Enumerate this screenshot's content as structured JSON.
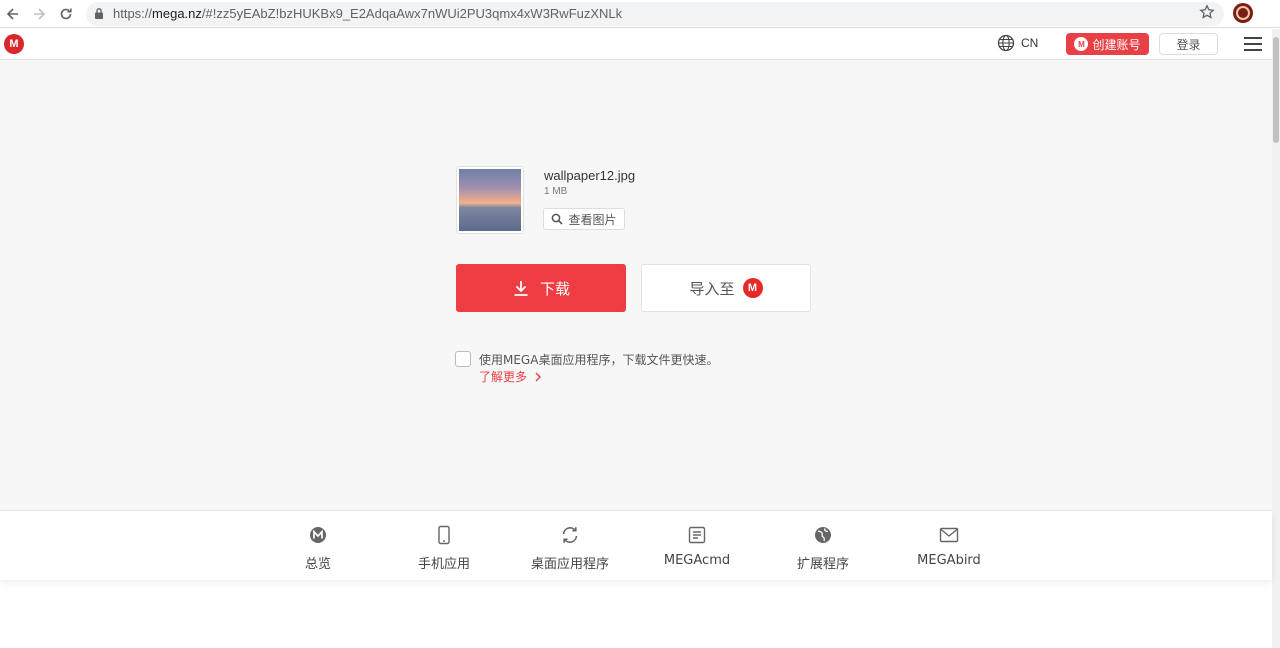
{
  "browser": {
    "url_scheme": "https://",
    "url_host": "mega.nz",
    "url_rest": "/#!zz5yEAbZ!bzHUKBx9_E2AdqaAwx7nWUi2PU3qmx4xW3RwFuzXNLk"
  },
  "topnav": {
    "logo": "M",
    "language": "CN",
    "create_account": "创建账号",
    "login": "登录"
  },
  "file": {
    "name": "wallpaper12.jpg",
    "size": "1 MB",
    "preview_label": "查看图片"
  },
  "actions": {
    "download": "下载",
    "import_to": "导入至",
    "import_badge": "M"
  },
  "desktop_prompt": {
    "text": "使用MEGA桌面应用程序，下载文件更快速。",
    "learn_more": "了解更多"
  },
  "bottom_tabs": [
    {
      "label": "总览",
      "icon": "mega-circle-icon"
    },
    {
      "label": "手机应用",
      "icon": "phone-icon"
    },
    {
      "label": "桌面应用程序",
      "icon": "sync-icon"
    },
    {
      "label": "MEGAcmd",
      "icon": "terminal-doc-icon"
    },
    {
      "label": "扩展程序",
      "icon": "globe-icon"
    },
    {
      "label": "MEGAbird",
      "icon": "mail-icon"
    }
  ],
  "colors": {
    "brand_red": "#d9272e",
    "download_red": "#ee3c42",
    "link_red": "#e94046"
  }
}
